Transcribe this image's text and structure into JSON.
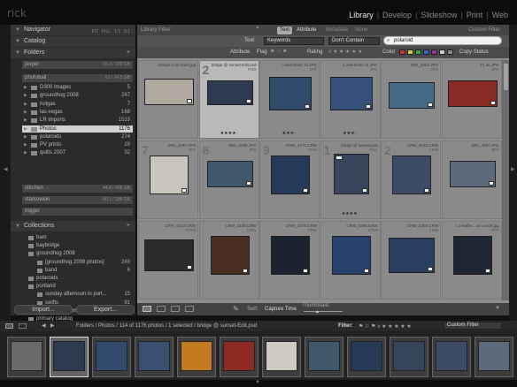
{
  "app": {
    "brand": "rick"
  },
  "modules": [
    {
      "label": "Library",
      "active": true
    },
    {
      "label": "Develop",
      "active": false
    },
    {
      "label": "Slideshow",
      "active": false
    },
    {
      "label": "Print",
      "active": false
    },
    {
      "label": "Web",
      "active": false
    }
  ],
  "navigator": {
    "title": "Navigator",
    "opts": [
      "FIT",
      "FILL",
      "1:1",
      "3:1"
    ]
  },
  "catalog": {
    "title": "Catalog"
  },
  "folders": {
    "title": "Folders",
    "volumes": [
      {
        "name": "jasper",
        "info": "16.3 / 299 GB"
      },
      {
        "name": "photoball",
        "info": "61 / 74.5 GB"
      },
      {
        "name": "stitchen",
        "info": "44.8 / 488 GB"
      },
      {
        "name": "starkowski",
        "info": "40.1 / 189 GB"
      },
      {
        "name": "trigger",
        "info": ""
      }
    ],
    "items": [
      {
        "name": "D300 images",
        "count": "5"
      },
      {
        "name": "groundhog 2008",
        "count": "267"
      },
      {
        "name": "holgas",
        "count": "7"
      },
      {
        "name": "las-vegas",
        "count": "168"
      },
      {
        "name": "LR imports",
        "count": "1519"
      },
      {
        "name": "Photos",
        "count": "1176"
      },
      {
        "name": "polaroids",
        "count": "274"
      },
      {
        "name": "PV prints",
        "count": "29"
      },
      {
        "name": "quilts 2007",
        "count": "32"
      }
    ]
  },
  "collections": {
    "title": "Collections",
    "items": [
      {
        "name": "bam",
        "count": ""
      },
      {
        "name": "baybridge",
        "count": ""
      },
      {
        "name": "groundhog 2008",
        "count": ""
      },
      {
        "name": "[groundhog 2008 photos]",
        "count": "249"
      },
      {
        "name": "band",
        "count": "6"
      },
      {
        "name": "polaroids",
        "count": ""
      },
      {
        "name": "portland",
        "count": ""
      },
      {
        "name": "sunday afternoon in port...",
        "count": "15"
      },
      {
        "name": "swifts",
        "count": "91"
      },
      {
        "name": "walk thru portland march 27",
        "count": "18"
      },
      {
        "name": "primary catalog",
        "count": ""
      }
    ]
  },
  "left_buttons": {
    "import": "Import...",
    "export": "Export..."
  },
  "library_filter": {
    "label": "Library Filter:",
    "tabs": [
      "Text",
      "Attribute",
      "Metadata",
      "None"
    ],
    "preset": "Custom Filter"
  },
  "text_filter": {
    "label": "Text",
    "field": "Keywords",
    "rule": "Don't Contain",
    "query": "polaroid"
  },
  "attribute_bar": {
    "label": "Attribute",
    "flag_label": "Flag",
    "rating_label": "Rating",
    "color_label": "Color",
    "copy_status_label": "Copy Status",
    "colors": [
      "#c33",
      "#cc3",
      "#3a3",
      "#36c",
      "#939",
      "#ccc",
      "#888"
    ]
  },
  "grid": {
    "cells": [
      {
        "title": "change is all hand.jpg",
        "sub": "",
        "num": "",
        "stars": "",
        "photo": "#b0a9a0",
        "selected": false,
        "flag": false
      },
      {
        "title": "bridge @ sunset-Edit.psd",
        "sub": "PSD",
        "num": "2",
        "stars": "★★★★·",
        "photo": "#2d3a50",
        "selected": true,
        "flag": false
      },
      {
        "title": "u wall shots 10.JPG",
        "sub": "JPG",
        "num": "",
        "stars": "★★★··",
        "photo": "#2f4a6a",
        "selected": false,
        "flag": false
      },
      {
        "title": "u wall shots 11.JPG",
        "sub": "JPG",
        "num": "",
        "stars": "★★★··",
        "photo": "#36507a",
        "selected": false,
        "flag": false
      },
      {
        "title": "IMG_4283.JPG",
        "sub": "JPG",
        "num": "",
        "stars": "",
        "photo": "#446a86",
        "selected": false,
        "flag": false
      },
      {
        "title": "it's ok.JPG",
        "sub": "JPG",
        "num": "",
        "stars": "",
        "photo": "#8a2a24",
        "selected": false,
        "flag": false
      },
      {
        "title": "IMG_4287.JPG",
        "sub": "JPG",
        "num": "7",
        "stars": "",
        "photo": "#c9c4bc",
        "selected": false,
        "flag": false
      },
      {
        "title": "IMG_4288.JPG",
        "sub": "JPG",
        "num": "8",
        "stars": "",
        "photo": "#40586a",
        "selected": false,
        "flag": false
      },
      {
        "title": "CRW_4271.CRW",
        "sub": "CRW",
        "num": "9",
        "stars": "",
        "photo": "#263a58",
        "selected": false,
        "flag": false
      },
      {
        "title": "bridge @ sunset.psd",
        "sub": "PSD",
        "num": "1",
        "stars": "★★★★·",
        "photo": "#37465c",
        "selected": false,
        "flag": true
      },
      {
        "title": "CRW_4281.CRW",
        "sub": "CRW",
        "num": "2",
        "stars": "",
        "photo": "#3c4c66",
        "selected": false,
        "flag": false
      },
      {
        "title": "IMG_4297.JPG",
        "sub": "JPG",
        "num": "",
        "stars": "",
        "photo": "#5c6a7c",
        "selected": false,
        "flag": false
      },
      {
        "title": "CRW_4212.CRW",
        "sub": "CRW",
        "num": "",
        "stars": "",
        "photo": "#2a2a2a",
        "selected": false,
        "flag": false
      },
      {
        "title": "CRW_4335.CRW",
        "sub": "CRW",
        "num": "",
        "stars": "",
        "photo": "#4a2e22",
        "selected": false,
        "flag": false
      },
      {
        "title": "CRW_4378.CRW",
        "sub": "CRW",
        "num": "",
        "stars": "",
        "photo": "#1c2230",
        "selected": false,
        "flag": false
      },
      {
        "title": "CRW_4355.CRW",
        "sub": "CRW",
        "num": "",
        "stars": "",
        "photo": "#27416b",
        "selected": false,
        "flag": false
      },
      {
        "title": "CRW_4356.CRW",
        "sub": "CRW",
        "num": "",
        "stars": "",
        "photo": "#2a3f60",
        "selected": false,
        "flag": false
      },
      {
        "title": "i 4 waffle... on a side.jpg",
        "sub": "JPG",
        "num": "",
        "stars": "",
        "photo": "#1e2633",
        "selected": false,
        "flag": false
      }
    ]
  },
  "toolbar": {
    "sort_label": "Sort:",
    "sort_value": "Capture Time",
    "thumb_label": "Thumbnails"
  },
  "filmstrip_head": {
    "path": "Folders / Photos / 114 of 1176 photos / 1 selected / bridge @ sunset-Edit.psd",
    "filter_label": "Filter:",
    "preset": "Custom Filter"
  },
  "filmstrip": [
    "#6a6a6a",
    "#2c3a52",
    "#324a6c",
    "#3a5070",
    "#c47a20",
    "#8e2a24",
    "#cfcac2",
    "#40586a",
    "#263a58",
    "#35465c",
    "#3c4c66",
    "#5c6a7c"
  ]
}
